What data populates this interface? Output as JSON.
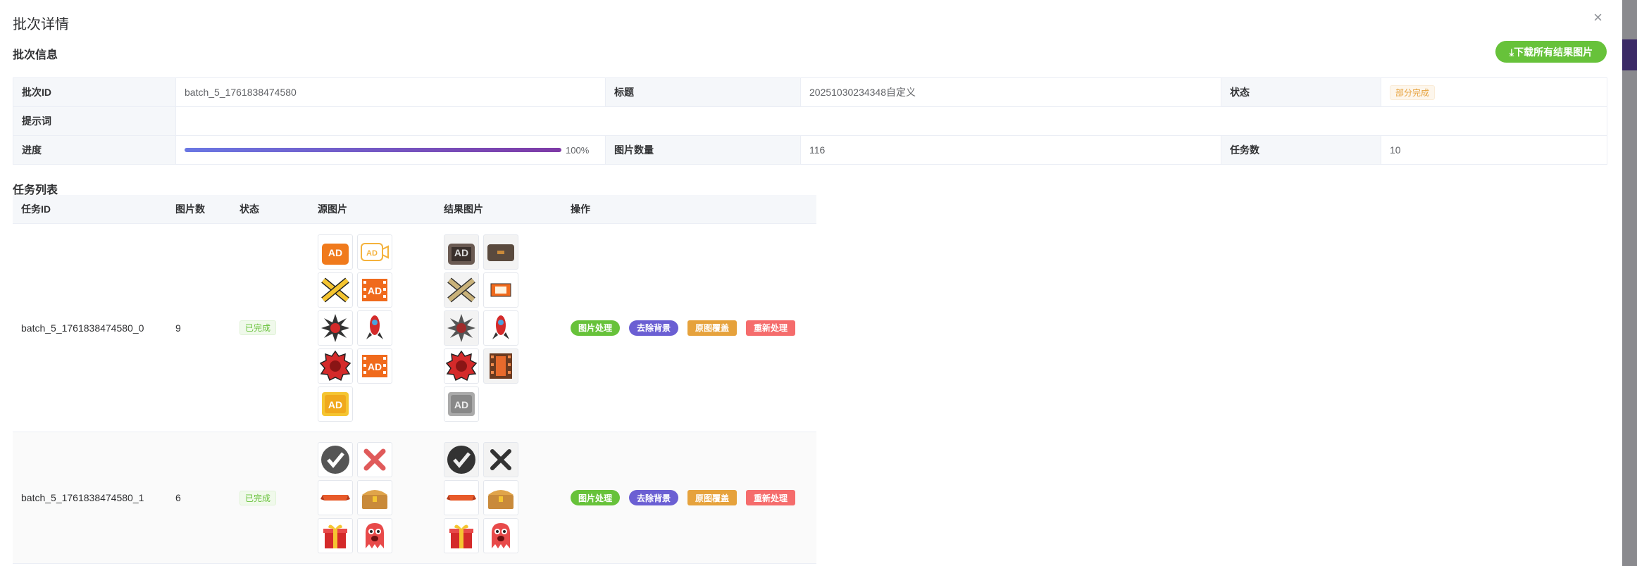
{
  "dialog": {
    "title": "批次详情",
    "close": "×"
  },
  "batch_info": {
    "heading": "批次信息",
    "download_all_label": "⤓下载所有结果图片",
    "labels": {
      "batch_id": "批次ID",
      "title": "标题",
      "status": "状态",
      "prompt": "提示词",
      "progress": "进度",
      "image_count": "图片数量",
      "task_count": "任务数"
    },
    "values": {
      "batch_id": "batch_5_1761838474580",
      "title": "20251030234348自定义",
      "status": "部分完成",
      "prompt": "",
      "progress_text": "100%",
      "progress_fraction": 1.0,
      "image_count": "116",
      "task_count": "10"
    }
  },
  "task_list": {
    "heading": "任务列表",
    "columns": [
      "任务ID",
      "图片数",
      "状态",
      "源图片",
      "结果图片",
      "操作"
    ],
    "actions": [
      "图片处理",
      "去除背景",
      "原图覆盖",
      "重新处理"
    ],
    "rows": [
      {
        "id": "batch_5_1761838474580_0",
        "count": "9",
        "status": "已完成",
        "source_icons": [
          "tv-ad-icon",
          "camera-ad-icon",
          "cross-band-icon",
          "film-ad-icon",
          "spiked-mine-icon",
          "rocket-icon",
          "gear-red-icon",
          "film-ad-icon",
          "ad-badge-icon"
        ],
        "result_icons": [
          "tv-ad-dark-icon",
          "case-dark-icon",
          "cross-band-dark-icon",
          "film-small-icon",
          "spiked-mine-dark-icon",
          "rocket-icon",
          "gear-red-icon",
          "film-dark-icon",
          "ad-badge-gray-icon"
        ]
      },
      {
        "id": "batch_5_1761838474580_1",
        "count": "6",
        "status": "已完成",
        "source_icons": [
          "check-circle-icon",
          "x-mark-icon",
          "ribbon-icon",
          "treasure-chest-icon",
          "gift-box-icon",
          "red-monster-icon"
        ],
        "result_icons": [
          "check-circle-dark-icon",
          "x-mark-dark-icon",
          "ribbon-icon",
          "treasure-chest-icon",
          "gift-box-icon",
          "red-monster-icon"
        ]
      }
    ]
  }
}
